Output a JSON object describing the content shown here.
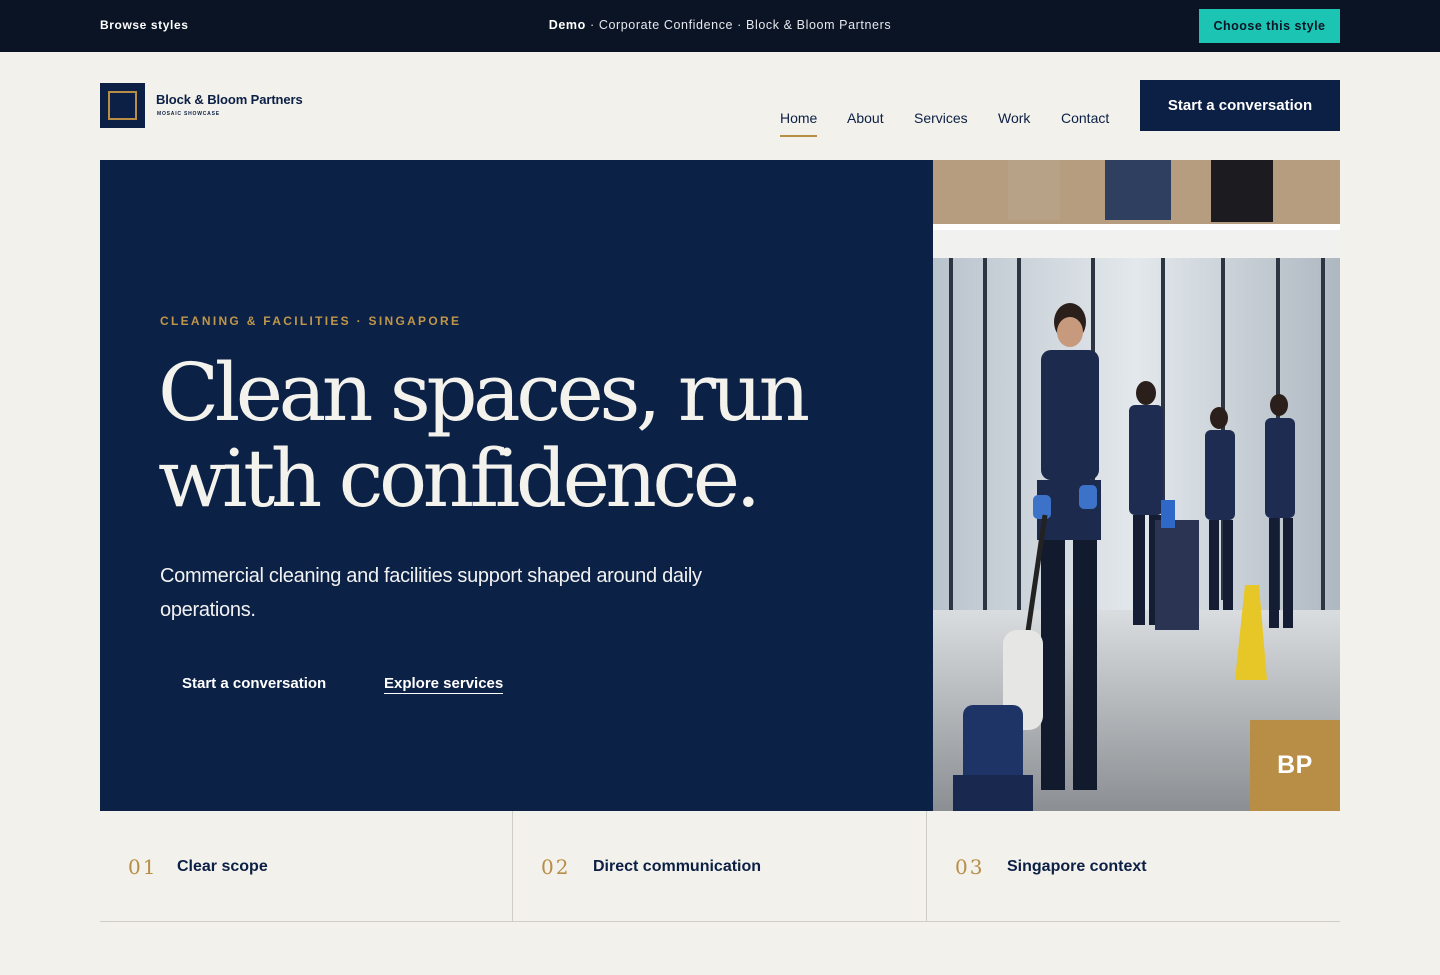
{
  "demo_bar": {
    "browse_label": "Browse styles",
    "demo_label": "Demo",
    "style_name": "Corporate Confidence",
    "site_name": "Block & Bloom Partners",
    "separator": " · ",
    "choose_label": "Choose this style",
    "accent_color": "#1cc4b3"
  },
  "header": {
    "brand_name": "Block & Bloom Partners",
    "brand_tagline": "MOSAIC SHOWCASE",
    "logo_icon": "square-frame-logo",
    "nav": [
      {
        "label": "Home",
        "active": true
      },
      {
        "label": "About"
      },
      {
        "label": "Services"
      },
      {
        "label": "Work"
      },
      {
        "label": "Contact"
      }
    ],
    "cta_label": "Start a conversation"
  },
  "hero": {
    "eyebrow": "CLEANING & FACILITIES · SINGAPORE",
    "headline_line1": "Clean spaces, run",
    "headline_line2": "with confidence.",
    "lead": "Commercial cleaning and facilities support shaped around daily operations.",
    "primary_cta": "Start a conversation",
    "secondary_cta": "Explore services",
    "background_color": "#0c2146",
    "accent_color": "#c0974a",
    "badge_text": "BP"
  },
  "features": [
    {
      "number": "01",
      "label": "Clear scope"
    },
    {
      "number": "02",
      "label": "Direct communication"
    },
    {
      "number": "03",
      "label": "Singapore context"
    }
  ]
}
